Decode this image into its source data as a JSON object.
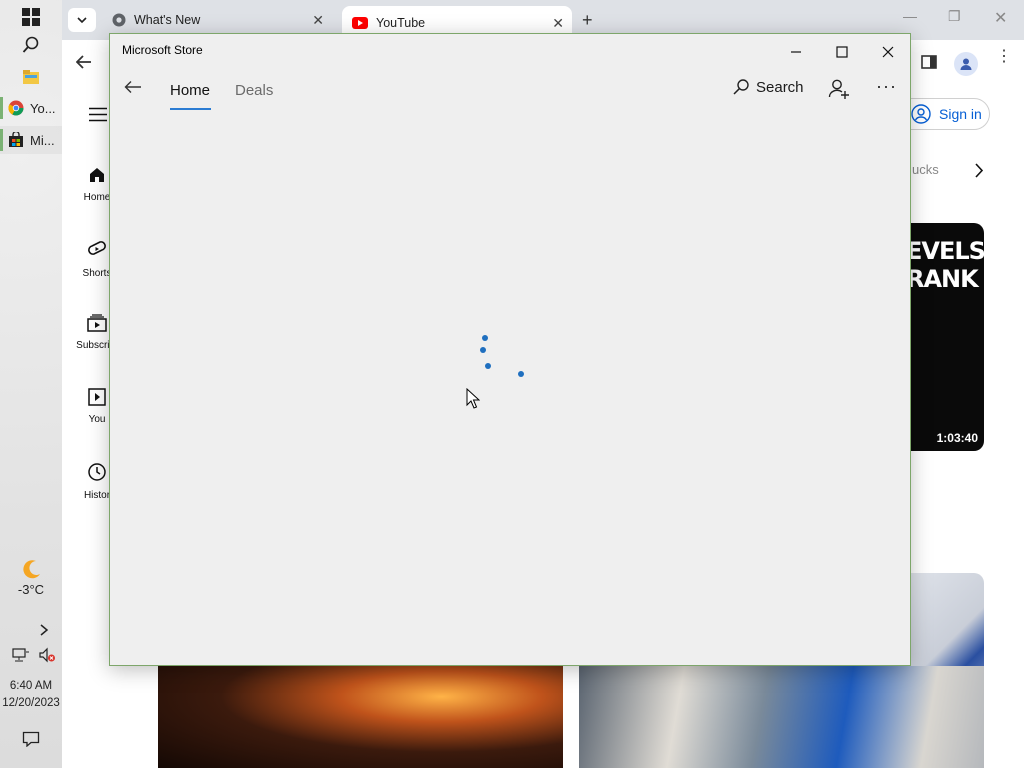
{
  "taskbar": {
    "apps": [
      {
        "label": "Yo...",
        "icon": "chrome-icon"
      },
      {
        "label": "Mi...",
        "icon": "store-icon"
      }
    ],
    "weather": {
      "temp": "-3°C"
    },
    "clock": {
      "time": "6:40 AM",
      "date": "12/20/2023"
    }
  },
  "browser": {
    "tabs": [
      {
        "title": "What's New",
        "active": false
      },
      {
        "title": "YouTube",
        "active": true
      }
    ]
  },
  "youtube": {
    "rail": [
      "Home",
      "Shorts",
      "Subscript",
      "You",
      "Histor"
    ],
    "sign_in": "Sign in",
    "chip": "ucks",
    "video1": {
      "title_lines": [
        "EVELS",
        "RANK"
      ],
      "duration": "1:03:40"
    }
  },
  "store": {
    "window_title": "Microsoft Store",
    "nav": {
      "home": "Home",
      "deals": "Deals",
      "search": "Search"
    }
  },
  "colors": {
    "accent": "#2b7cd3",
    "spinner": "#1f6fbf",
    "store_border": "#7da66a"
  }
}
